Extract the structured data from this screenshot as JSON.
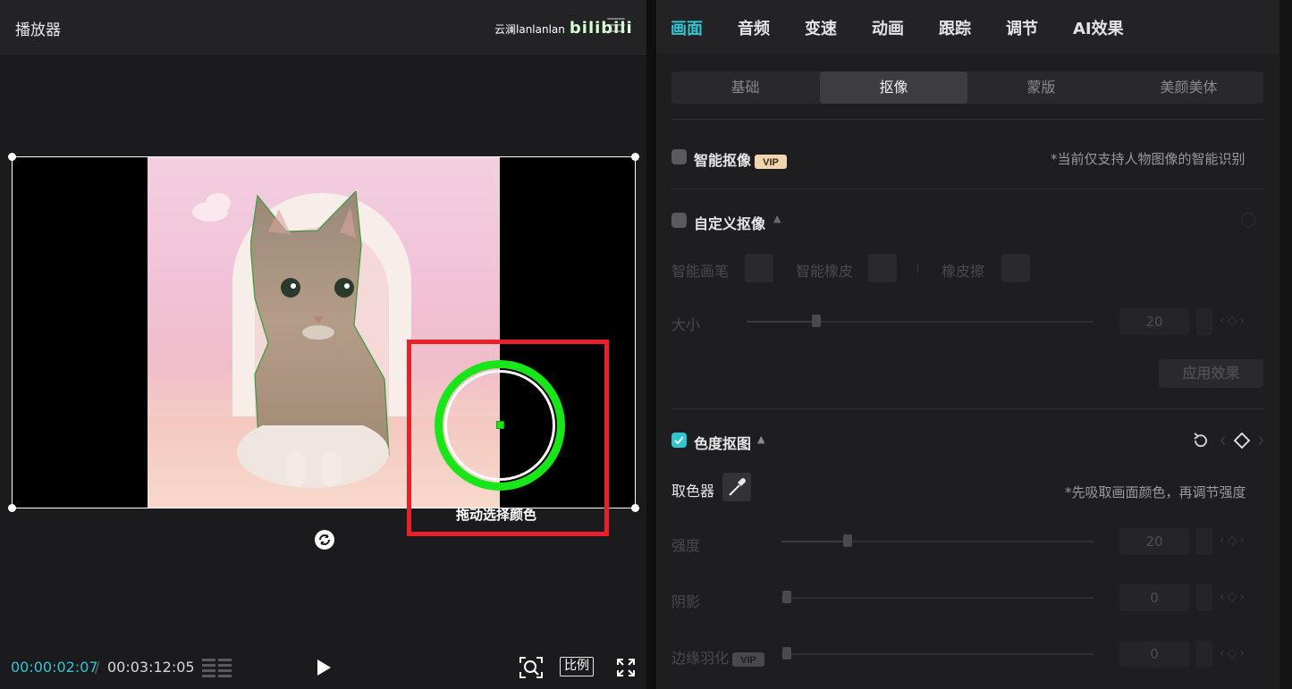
{
  "player": {
    "title": "播放器",
    "watermark_text": "云澜lanlanlan",
    "watermark_logo": "bilibili",
    "picker_hint": "拖动选择颜色",
    "time_current": "00:00:02:07",
    "time_separator": "/",
    "time_total": "00:03:12:05",
    "ratio_label": "比例",
    "highlight_color": "#e8202a",
    "picker_color": "#19e619"
  },
  "inspector": {
    "tabs": [
      "画面",
      "音频",
      "变速",
      "动画",
      "跟踪",
      "调节",
      "AI效果"
    ],
    "active_tab": "画面",
    "subtabs": [
      "基础",
      "抠像",
      "蒙版",
      "美颜美体"
    ],
    "active_subtab": "抠像",
    "smart_cutout": {
      "label": "智能抠像",
      "badge": "VIP",
      "note": "*当前仅支持人物图像的智能识别",
      "checked": false
    },
    "custom_cutout": {
      "label": "自定义抠像",
      "checked": false,
      "tools": [
        "智能画笔",
        "智能橡皮",
        "橡皮擦"
      ],
      "size_label": "大小",
      "size_value": "20",
      "apply_label": "应用效果"
    },
    "chroma_key": {
      "label": "色度抠图",
      "checked": true,
      "picker_label": "取色器",
      "picker_note": "*先吸取画面颜色，再调节强度",
      "strength_label": "强度",
      "strength_value": "20",
      "shadow_label": "阴影",
      "shadow_value": "0",
      "feather_label": "边缘羽化",
      "feather_badge": "VIP",
      "feather_value": "0"
    },
    "accent_color": "#2fc6d3"
  }
}
